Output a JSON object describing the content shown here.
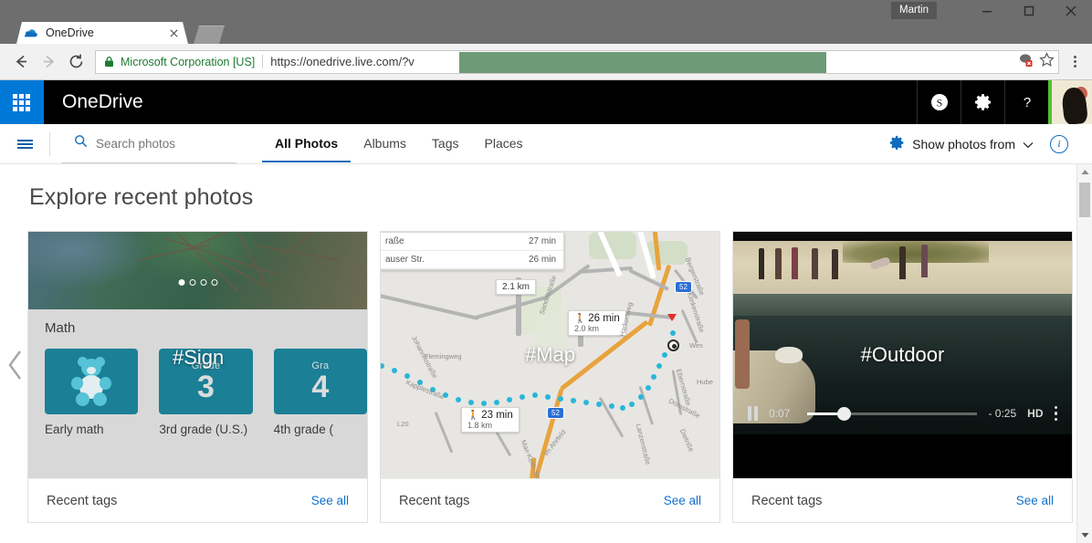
{
  "browser": {
    "window_tooltip": "Martin",
    "window_controls": [
      "minimize",
      "maximize",
      "close"
    ],
    "tab": {
      "title": "OneDrive",
      "favicon": "onedrive-cloud-icon",
      "close": "×"
    },
    "new_tab_label": "",
    "nav": {
      "back": "←",
      "forward": "→",
      "reload": "⟳"
    },
    "omnibox": {
      "lock_icon": "lock-icon",
      "security_text": "Microsoft Corporation [US]",
      "url": "https://onedrive.live.com/?v",
      "url_domain": "onedrive.live.com",
      "redacted": true,
      "extension_icon": "extension-icon",
      "bookmark_icon": "star-icon"
    },
    "menu": "chrome-menu"
  },
  "onedrive_header": {
    "waffle": "app-launcher",
    "brand": "OneDrive",
    "buttons": [
      {
        "name": "skype",
        "glyph": "S"
      },
      {
        "name": "settings",
        "glyph": "gear"
      },
      {
        "name": "help",
        "glyph": "?"
      }
    ],
    "avatar": "user-avatar",
    "avatar_accent": "#53c132"
  },
  "nav": {
    "hamburger": "menu",
    "search": {
      "placeholder": "Search photos",
      "value": "",
      "icon": "search-icon"
    },
    "tabs": [
      {
        "label": "All Photos",
        "active": true
      },
      {
        "label": "Albums",
        "active": false
      },
      {
        "label": "Tags",
        "active": false
      },
      {
        "label": "Places",
        "active": false
      }
    ],
    "show_photos_from": "Show photos from",
    "chevron": "⌄",
    "info": "i"
  },
  "page": {
    "title": "Explore recent photos",
    "prev_arrow": "‹"
  },
  "cards": [
    {
      "tag": "",
      "footer_label": "Recent tags",
      "see_all": "See all",
      "content": {
        "kind": "khan-academy-screenshot",
        "heading": "Math",
        "carousel_dots": 4,
        "carousel_active": 1,
        "tiles": [
          {
            "caption": "Early math",
            "art": "teddy-bear",
            "grade_label": "",
            "grade_num": ""
          },
          {
            "caption": "3rd grade (U.S.)",
            "art": "grade",
            "grade_label": "Grade",
            "grade_num": "3"
          },
          {
            "caption": "4th grade (",
            "art": "grade",
            "grade_label": "Gra",
            "grade_num": "4"
          }
        ],
        "overlay_text": "#Sign"
      }
    },
    {
      "tag": "#Map",
      "footer_label": "Recent tags",
      "see_all": "See all",
      "content": {
        "kind": "map-screenshot",
        "panel_rows": [
          {
            "street": "raße",
            "time": "27 min"
          },
          {
            "street": "auser Str.",
            "time": "26 min"
          }
        ],
        "distance_small": "2.1 km",
        "route_labels": [
          {
            "time": "26 min",
            "dist": "2.0 km"
          },
          {
            "time": "23 min",
            "dist": "1.8 km"
          }
        ],
        "highway_shields": [
          "52",
          "52"
        ],
        "street_names": [
          "Bergerstraße",
          "Klinkenstraße",
          "Johannisstraße",
          "Flemingweg",
          "Kapplestraße",
          "Sandelstraße",
          "Ebernstraße",
          "Dornstraße",
          "Im Ahrfeld",
          "Max-Keith-Straße",
          "Lanzenstraße",
          "Wes",
          "Harkortweg",
          "Hube",
          "Dietriße",
          "L20"
        ]
      }
    },
    {
      "tag": "#Outdoor",
      "footer_label": "Recent tags",
      "see_all": "See all",
      "content": {
        "kind": "video-player",
        "state": "playing",
        "pause_icon": "pause-icon",
        "elapsed": "0:07",
        "remaining": "- 0:25",
        "quality": "HD",
        "progress_percent": 22,
        "more_menu": "kebab-menu"
      }
    }
  ],
  "scrollbar": {
    "up": "▲",
    "down": "▼",
    "thumb_position": "top"
  }
}
